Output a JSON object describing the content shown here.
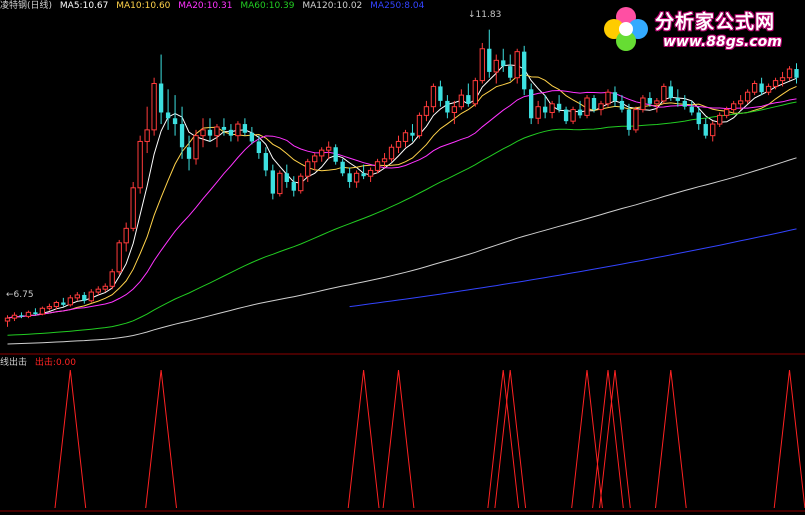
{
  "chart_data": {
    "type": "candlestick",
    "main_panel": {
      "legend": {
        "name": "凌特钢(日线)",
        "items": [
          {
            "label": "MA5:",
            "value": "10.67",
            "color": "#ffffff"
          },
          {
            "label": "MA10:",
            "value": "10.60",
            "color": "#ffd24a"
          },
          {
            "label": "MA20:",
            "value": "10.31",
            "color": "#ff33ff"
          },
          {
            "label": "MA60:",
            "value": "10.39",
            "color": "#22cc22"
          },
          {
            "label": "MA120:",
            "value": "10.02",
            "color": "#cfcfcf"
          },
          {
            "label": "MA250:",
            "value": "8.04",
            "color": "#3344ff"
          }
        ]
      },
      "y_range": [
        6.3,
        12.1
      ],
      "annotations": {
        "high": "11.83",
        "low": "6.75",
        "high_arrow": "↓",
        "low_arrow": "←"
      },
      "candles": [
        [
          6.8,
          6.9,
          6.7,
          6.85
        ],
        [
          6.85,
          6.95,
          6.8,
          6.9
        ],
        [
          6.9,
          6.95,
          6.85,
          6.88
        ],
        [
          6.88,
          6.98,
          6.85,
          6.95
        ],
        [
          6.95,
          7.02,
          6.9,
          6.92
        ],
        [
          6.92,
          7.05,
          6.9,
          7.02
        ],
        [
          7.02,
          7.1,
          6.98,
          7.05
        ],
        [
          7.05,
          7.15,
          7.0,
          7.12
        ],
        [
          7.12,
          7.2,
          7.05,
          7.08
        ],
        [
          7.08,
          7.25,
          7.05,
          7.2
        ],
        [
          7.2,
          7.3,
          7.15,
          7.25
        ],
        [
          7.25,
          7.3,
          7.1,
          7.15
        ],
        [
          7.15,
          7.35,
          7.12,
          7.3
        ],
        [
          7.3,
          7.4,
          7.25,
          7.35
        ],
        [
          7.35,
          7.45,
          7.3,
          7.4
        ],
        [
          7.4,
          7.7,
          7.35,
          7.65
        ],
        [
          7.65,
          8.2,
          7.6,
          8.15
        ],
        [
          8.15,
          8.5,
          8.0,
          8.4
        ],
        [
          8.4,
          9.2,
          8.35,
          9.1
        ],
        [
          9.1,
          10.0,
          9.0,
          9.9
        ],
        [
          9.9,
          10.5,
          9.7,
          10.1
        ],
        [
          10.1,
          11.0,
          10.0,
          10.9
        ],
        [
          10.9,
          11.4,
          10.2,
          10.4
        ],
        [
          10.4,
          10.8,
          10.1,
          10.3
        ],
        [
          10.3,
          10.7,
          10.0,
          10.2
        ],
        [
          10.2,
          10.5,
          9.6,
          9.8
        ],
        [
          9.8,
          10.0,
          9.4,
          9.6
        ],
        [
          9.6,
          10.1,
          9.5,
          10.0
        ],
        [
          10.0,
          10.3,
          9.8,
          10.1
        ],
        [
          10.1,
          10.3,
          9.9,
          10.0
        ],
        [
          10.0,
          10.2,
          9.8,
          10.15
        ],
        [
          10.15,
          10.3,
          10.0,
          10.1
        ],
        [
          10.1,
          10.2,
          9.9,
          10.0
        ],
        [
          10.0,
          10.25,
          9.9,
          10.2
        ],
        [
          10.2,
          10.3,
          10.0,
          10.05
        ],
        [
          10.05,
          10.15,
          9.85,
          9.9
        ],
        [
          9.9,
          10.0,
          9.6,
          9.7
        ],
        [
          9.7,
          9.8,
          9.3,
          9.4
        ],
        [
          9.4,
          9.5,
          8.9,
          9.0
        ],
        [
          9.0,
          9.4,
          8.95,
          9.35
        ],
        [
          9.35,
          9.5,
          9.1,
          9.2
        ],
        [
          9.2,
          9.3,
          8.95,
          9.05
        ],
        [
          9.05,
          9.35,
          9.0,
          9.3
        ],
        [
          9.3,
          9.6,
          9.2,
          9.55
        ],
        [
          9.55,
          9.7,
          9.4,
          9.65
        ],
        [
          9.65,
          9.8,
          9.55,
          9.75
        ],
        [
          9.75,
          9.9,
          9.6,
          9.8
        ],
        [
          9.8,
          9.85,
          9.5,
          9.55
        ],
        [
          9.55,
          9.6,
          9.3,
          9.35
        ],
        [
          9.35,
          9.45,
          9.1,
          9.2
        ],
        [
          9.2,
          9.4,
          9.1,
          9.35
        ],
        [
          9.35,
          9.5,
          9.25,
          9.3
        ],
        [
          9.3,
          9.45,
          9.2,
          9.4
        ],
        [
          9.4,
          9.6,
          9.35,
          9.55
        ],
        [
          9.55,
          9.7,
          9.45,
          9.6
        ],
        [
          9.6,
          9.85,
          9.55,
          9.8
        ],
        [
          9.8,
          10.0,
          9.7,
          9.9
        ],
        [
          9.9,
          10.1,
          9.8,
          10.05
        ],
        [
          10.05,
          10.2,
          9.9,
          10.0
        ],
        [
          10.0,
          10.4,
          9.95,
          10.35
        ],
        [
          10.35,
          10.6,
          10.25,
          10.5
        ],
        [
          10.5,
          10.9,
          10.4,
          10.85
        ],
        [
          10.85,
          10.95,
          10.5,
          10.6
        ],
        [
          10.6,
          10.7,
          10.3,
          10.4
        ],
        [
          10.4,
          10.6,
          10.2,
          10.5
        ],
        [
          10.5,
          10.8,
          10.45,
          10.7
        ],
        [
          10.7,
          10.9,
          10.5,
          10.55
        ],
        [
          10.55,
          11.0,
          10.5,
          10.95
        ],
        [
          10.95,
          11.6,
          10.9,
          11.5
        ],
        [
          11.5,
          11.83,
          11.0,
          11.1
        ],
        [
          11.1,
          11.4,
          10.9,
          11.3
        ],
        [
          11.3,
          11.5,
          11.1,
          11.2
        ],
        [
          11.2,
          11.4,
          10.95,
          11.0
        ],
        [
          11.0,
          11.5,
          10.9,
          11.45
        ],
        [
          11.45,
          11.55,
          10.7,
          10.8
        ],
        [
          10.8,
          10.9,
          10.2,
          10.3
        ],
        [
          10.3,
          10.6,
          10.2,
          10.5
        ],
        [
          10.5,
          10.7,
          10.3,
          10.4
        ],
        [
          10.4,
          10.6,
          10.3,
          10.55
        ],
        [
          10.55,
          10.7,
          10.4,
          10.45
        ],
        [
          10.45,
          10.5,
          10.2,
          10.25
        ],
        [
          10.25,
          10.5,
          10.2,
          10.45
        ],
        [
          10.45,
          10.6,
          10.3,
          10.35
        ],
        [
          10.35,
          10.7,
          10.3,
          10.65
        ],
        [
          10.65,
          10.7,
          10.4,
          10.45
        ],
        [
          10.45,
          10.6,
          10.35,
          10.55
        ],
        [
          10.55,
          10.8,
          10.5,
          10.75
        ],
        [
          10.75,
          10.85,
          10.5,
          10.6
        ],
        [
          10.6,
          10.7,
          10.4,
          10.45
        ],
        [
          10.45,
          10.55,
          10.0,
          10.1
        ],
        [
          10.1,
          10.5,
          10.05,
          10.45
        ],
        [
          10.45,
          10.7,
          10.4,
          10.65
        ],
        [
          10.65,
          10.75,
          10.5,
          10.55
        ],
        [
          10.55,
          10.65,
          10.4,
          10.6
        ],
        [
          10.6,
          10.9,
          10.55,
          10.85
        ],
        [
          10.85,
          10.95,
          10.6,
          10.65
        ],
        [
          10.65,
          10.8,
          10.5,
          10.6
        ],
        [
          10.6,
          10.7,
          10.45,
          10.5
        ],
        [
          10.5,
          10.6,
          10.35,
          10.4
        ],
        [
          10.4,
          10.5,
          10.1,
          10.2
        ],
        [
          10.2,
          10.3,
          9.95,
          10.0
        ],
        [
          10.0,
          10.25,
          9.9,
          10.2
        ],
        [
          10.2,
          10.4,
          10.15,
          10.35
        ],
        [
          10.35,
          10.5,
          10.3,
          10.45
        ],
        [
          10.45,
          10.6,
          10.4,
          10.55
        ],
        [
          10.55,
          10.7,
          10.45,
          10.6
        ],
        [
          10.6,
          10.8,
          10.55,
          10.75
        ],
        [
          10.75,
          10.95,
          10.7,
          10.9
        ],
        [
          10.9,
          11.0,
          10.7,
          10.75
        ],
        [
          10.75,
          10.9,
          10.7,
          10.85
        ],
        [
          10.85,
          11.0,
          10.8,
          10.95
        ],
        [
          10.95,
          11.1,
          10.85,
          11.0
        ],
        [
          11.0,
          11.2,
          10.95,
          11.15
        ],
        [
          11.15,
          11.25,
          10.9,
          11.0
        ]
      ]
    },
    "sub_panel": {
      "legend": {
        "name": "线出击",
        "label": "出击:",
        "value": "0.00",
        "color": "#ff2222"
      },
      "signal_value": 1,
      "signals": [
        9,
        22,
        51,
        56,
        71,
        72,
        83,
        86,
        87,
        95,
        112,
        118,
        124,
        131,
        135,
        139,
        144,
        150,
        158
      ]
    }
  },
  "watermark": {
    "title": "分析家公式网",
    "url": "www.88gs.com"
  }
}
